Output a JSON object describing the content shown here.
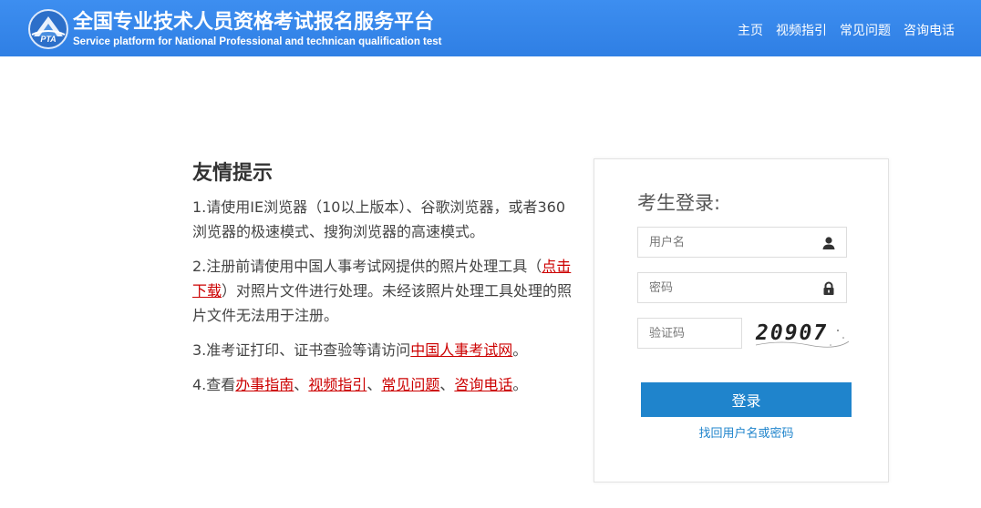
{
  "header": {
    "title": "全国专业技术人员资格考试报名服务平台",
    "subtitle": "Service platform for National Professional and technican qualification test",
    "logo_text": "PTA",
    "nav": [
      "主页",
      "视频指引",
      "常见问题",
      "咨询电话"
    ]
  },
  "notice": {
    "title": "友情提示",
    "item1": "1.请使用IE浏览器（10以上版本）、谷歌浏览器，或者360浏览器的极速模式、搜狗浏览器的高速模式。",
    "item2_pre": "2.注册前请使用中国人事考试网提供的照片处理工具（",
    "item2_link": "点击下载",
    "item2_post": "）对照片文件进行处理。未经该照片处理工具处理的照片文件无法用于注册。",
    "item3_pre": "3.准考证打印、证书查验等请访问",
    "item3_link": "中国人事考试网",
    "item3_post": "。",
    "item4_pre": "4.查看",
    "item4_links": [
      "办事指南",
      "视频指引",
      "常见问题",
      "咨询电话"
    ],
    "item4_sep": "、",
    "item4_post": "。"
  },
  "login": {
    "title": "考生登录:",
    "username_placeholder": "用户名",
    "password_placeholder": "密码",
    "captcha_placeholder": "验证码",
    "captcha_code": "20907",
    "submit_label": "登录",
    "recover_label": "找回用户名或密码"
  },
  "colors": {
    "header_bg": "#3388ee",
    "link_red": "#cc0000",
    "button_blue": "#1f84cc"
  },
  "icons": [
    "logo-icon",
    "user-icon",
    "lock-icon"
  ]
}
